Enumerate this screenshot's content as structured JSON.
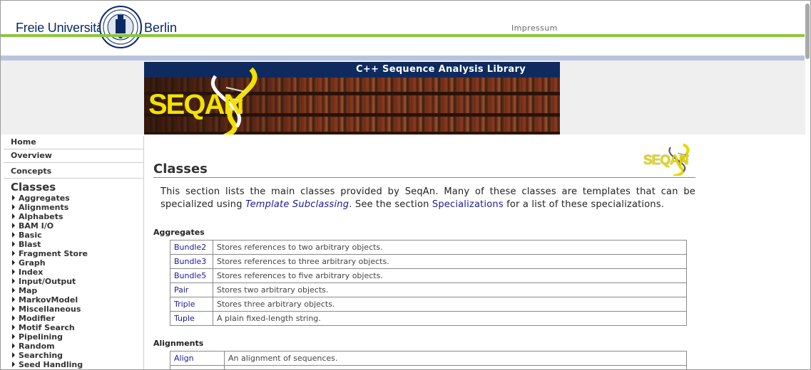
{
  "header": {
    "university_left": "Freie Universität",
    "university_right": "Berlin",
    "impressum": "Impressum"
  },
  "banner": {
    "title": "C++ Sequence Analysis Library",
    "logo_text": "SEQAN"
  },
  "nav": {
    "top_links": [
      "Home",
      "Overview",
      "Concepts"
    ],
    "heading": "Classes",
    "items": [
      "Aggregates",
      "Alignments",
      "Alphabets",
      "BAM I/O",
      "Basic",
      "Blast",
      "Fragment Store",
      "Graph",
      "Index",
      "Input/Output",
      "Map",
      "MarkovModel",
      "Miscellaneous",
      "Modifier",
      "Motif Search",
      "Pipelining",
      "Random",
      "Searching",
      "Seed Handling"
    ]
  },
  "main": {
    "title": "Classes",
    "logo_text": "SEQAN",
    "intro_1": "This section lists the main classes provided by SeqAn. Many of these classes are templates that can be specialized using ",
    "intro_link_1": "Template Subclassing",
    "intro_2": ". See the section ",
    "intro_link_2": "Specializations",
    "intro_3": " for a list of these specializations.",
    "sections": [
      {
        "heading": "Aggregates",
        "rows": [
          {
            "name": "Bundle2",
            "desc": "Stores references to two arbitrary objects."
          },
          {
            "name": "Bundle3",
            "desc": "Stores references to three arbitrary objects."
          },
          {
            "name": "Bundle5",
            "desc": "Stores references to five arbitrary objects."
          },
          {
            "name": "Pair",
            "desc": "Stores two arbitrary objects."
          },
          {
            "name": "Triple",
            "desc": "Stores three arbitrary objects."
          },
          {
            "name": "Tuple",
            "desc": "A plain fixed-length string."
          }
        ]
      },
      {
        "heading": "Alignments",
        "rows": [
          {
            "name": "Align",
            "desc": "An alignment of sequences."
          },
          {
            "name": "",
            "desc": ""
          }
        ]
      }
    ]
  },
  "colors": {
    "navy": "#0e2a5e",
    "green_rule": "#8dc63f",
    "link": "#1a1a99",
    "logo_yellow": "#f2e200"
  }
}
